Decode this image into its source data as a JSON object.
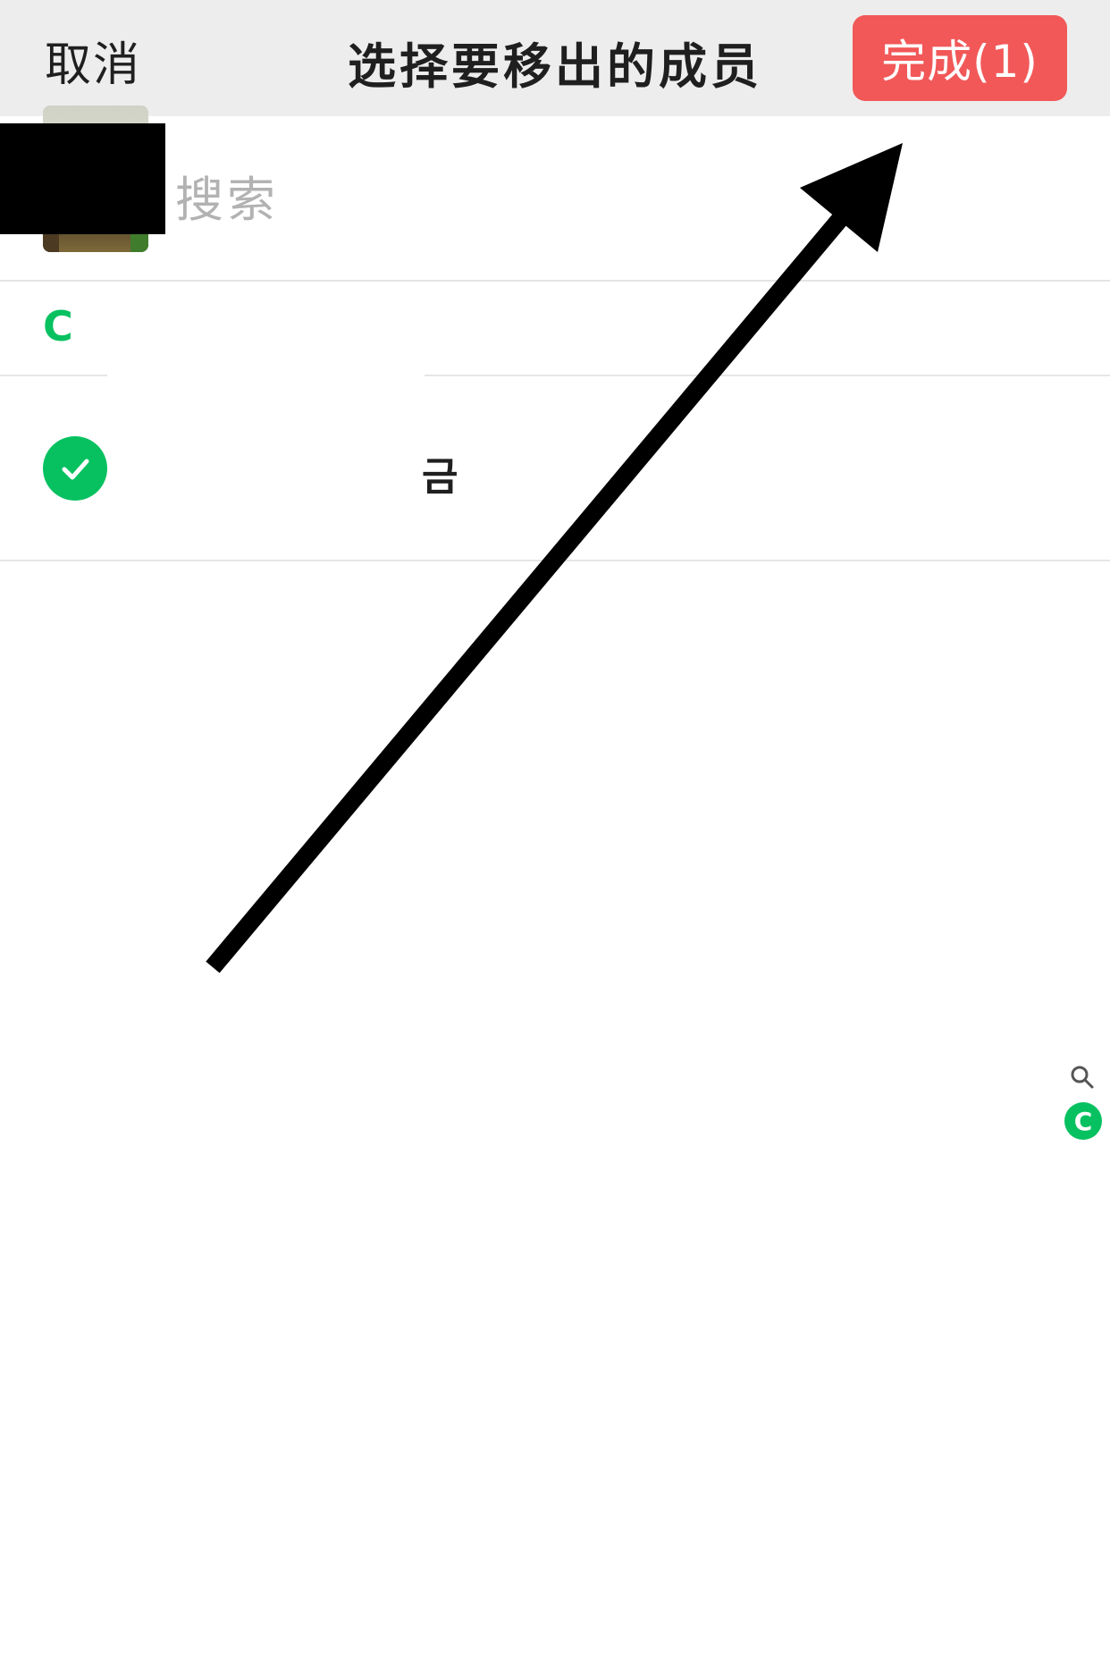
{
  "header": {
    "cancel_label": "取消",
    "title": "选择要移出的成员",
    "done_label": "完成(1)",
    "done_color": "#f25858"
  },
  "search": {
    "placeholder": "搜索"
  },
  "sections": [
    {
      "letter": "C",
      "members": [
        {
          "name": "",
          "suffix": "금",
          "selected": true
        }
      ]
    }
  ],
  "index_bar": {
    "search_icon": "search-icon",
    "letters": [
      "C"
    ]
  },
  "colors": {
    "accent_green": "#07c160",
    "header_bg": "#ededed"
  }
}
